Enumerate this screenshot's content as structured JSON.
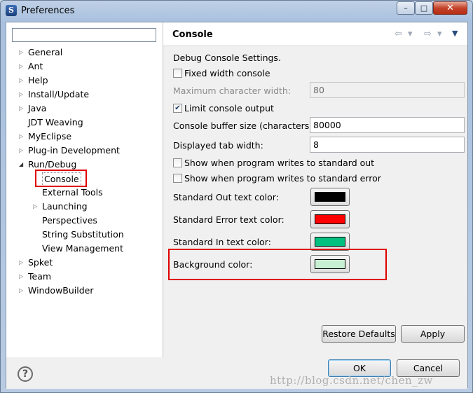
{
  "window": {
    "title": "Preferences",
    "controls": {
      "minimize": "–",
      "maximize": "□",
      "close": "✕"
    }
  },
  "filter": {
    "value": ""
  },
  "tree": [
    {
      "label": "General",
      "expandable": true
    },
    {
      "label": "Ant",
      "expandable": true
    },
    {
      "label": "Help",
      "expandable": true
    },
    {
      "label": "Install/Update",
      "expandable": true
    },
    {
      "label": "Java",
      "expandable": true
    },
    {
      "label": "JDT Weaving",
      "expandable": false
    },
    {
      "label": "MyEclipse",
      "expandable": true
    },
    {
      "label": "Plug-in Development",
      "expandable": true
    },
    {
      "label": "Run/Debug",
      "expandable": true,
      "expanded": true
    },
    {
      "label": "Console",
      "selected": true
    },
    {
      "label": "External Tools"
    },
    {
      "label": "Launching",
      "expandable": true
    },
    {
      "label": "Perspectives"
    },
    {
      "label": "String Substitution"
    },
    {
      "label": "View Management"
    },
    {
      "label": "Spket",
      "expandable": true
    },
    {
      "label": "Team",
      "expandable": true
    },
    {
      "label": "WindowBuilder",
      "expandable": true
    }
  ],
  "page": {
    "title": "Console",
    "nav": {
      "back": "⇦ ▾",
      "forward": "⇨ ▾",
      "menu": "▼"
    },
    "description": "Debug Console Settings.",
    "fixed_width": {
      "label": "Fixed width console",
      "checked": false
    },
    "max_char_width": {
      "label": "Maximum character width:",
      "value": "80"
    },
    "limit_output": {
      "label": "Limit console output",
      "checked": true
    },
    "buffer_size": {
      "label": "Console buffer size (characters):",
      "value": "80000"
    },
    "tab_width": {
      "label": "Displayed tab width:",
      "value": "8"
    },
    "show_out": {
      "label": "Show when program writes to standard out",
      "checked": false
    },
    "show_err": {
      "label": "Show when program writes to standard error",
      "checked": false
    },
    "colors": {
      "std_out": {
        "label": "Standard Out text color:",
        "color": "#000000"
      },
      "std_err": {
        "label": "Standard Error text color:",
        "color": "#ff0000"
      },
      "std_in": {
        "label": "Standard In text color:",
        "color": "#00c080"
      },
      "background": {
        "label": "Background color:",
        "color": "#c8f0d4"
      }
    },
    "restore_defaults": "Restore Defaults",
    "apply": "Apply"
  },
  "footer": {
    "help": "?",
    "ok": "OK",
    "cancel": "Cancel"
  },
  "watermark": "http://blog.csdn.net/chen_zw"
}
